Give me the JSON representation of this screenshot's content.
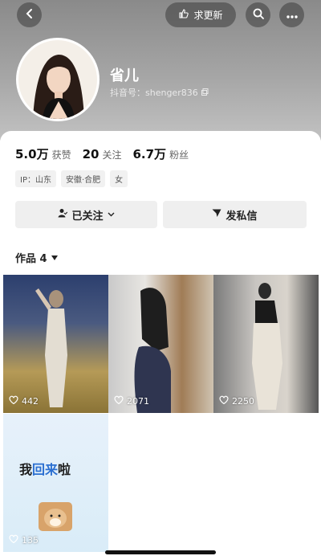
{
  "topbar": {
    "update_label": "求更新"
  },
  "profile": {
    "nickname": "省儿",
    "douyin_id": "抖音号：shenger836"
  },
  "stats": [
    {
      "value": "5.0万",
      "label": "获赞"
    },
    {
      "value": "20",
      "label": "关注"
    },
    {
      "value": "6.7万",
      "label": "粉丝"
    }
  ],
  "tags": [
    "IP：山东",
    "安徽·合肥",
    "女"
  ],
  "actions": {
    "follow_label": "已关注",
    "message_label": "发私信"
  },
  "works": {
    "tab_label": "作品 4",
    "items": [
      {
        "likes": "442"
      },
      {
        "likes": "2071"
      },
      {
        "likes": "2250"
      },
      {
        "likes": "135",
        "text_part1": "我",
        "text_part2": "回来",
        "text_part3": "啦"
      }
    ]
  },
  "colors": {
    "header_gray": "#9a9a9a",
    "button_bg": "#efefef",
    "accent_blue": "#2b6fd1"
  }
}
